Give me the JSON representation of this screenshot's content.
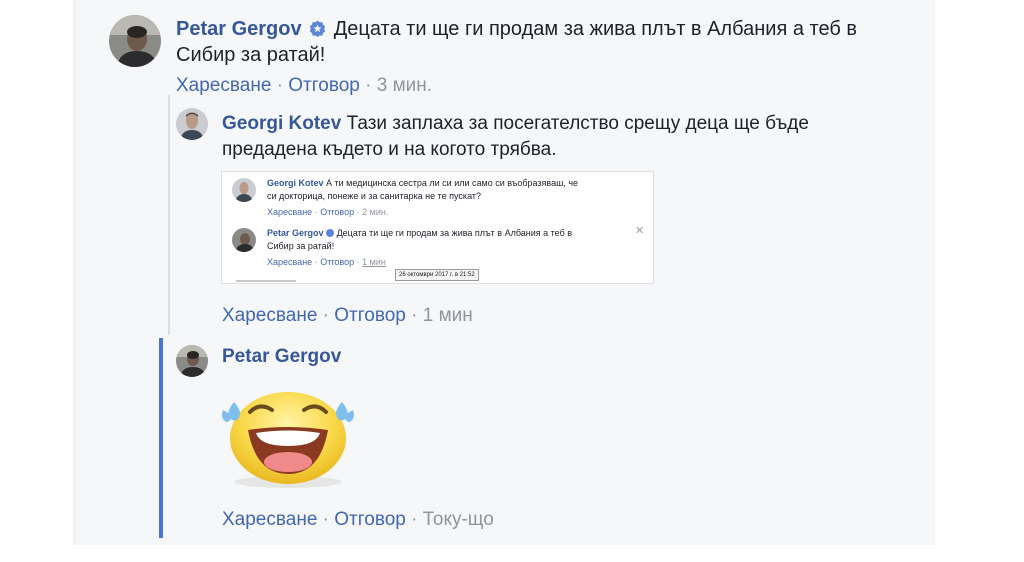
{
  "comment1": {
    "author": "Petar Gergov",
    "verified_icon": "verified-badge-icon",
    "text_line1": "Децата ти ще ги продам за жива плът в Албания а теб в",
    "text_line2": "Сибир за ратай!",
    "actions": {
      "like": "Харесване",
      "reply": "Отговор",
      "time": "3 мин."
    }
  },
  "reply1": {
    "author": "Georgi Kotev",
    "text_line1": "Тази заплаха за посегателство срещу деца ще бъде",
    "text_line2": "предадена където и на когото трябва.",
    "attachment": {
      "c1_author": "Georgi Kotev",
      "c1_line1": "А ти медицинска сестра ли си или само си въобразяваш, че",
      "c1_line2": "си докторица, понеже и за санитарка не те пускат?",
      "c1_like": "Харесване",
      "c1_reply": "Отговор",
      "c1_time": "2 мин.",
      "c2_author": "Petar Gergov",
      "c2_line1": "Децата ти ще ги продам за жива плът в Албания а теб в",
      "c2_line2": "Сибир за ратай!",
      "c2_like": "Харесване",
      "c2_reply": "Отговор",
      "c2_time": "1 мин",
      "tooltip": "26 октомври 2017 г. в 21:52",
      "close_icon": "close-icon"
    },
    "actions": {
      "like": "Харесване",
      "reply": "Отговор",
      "time": "1 мин"
    }
  },
  "reply2": {
    "author": "Petar Gergov",
    "sticker": "laughing-tears-emoji-sticker",
    "actions": {
      "like": "Харесване",
      "reply": "Отговор",
      "time": "Току-що"
    }
  },
  "colors": {
    "name": "#365899",
    "action": "#4267b2",
    "muted": "#90949c",
    "thread_accent": "#4a74d4",
    "panel_bg": "#f6f7f9"
  }
}
